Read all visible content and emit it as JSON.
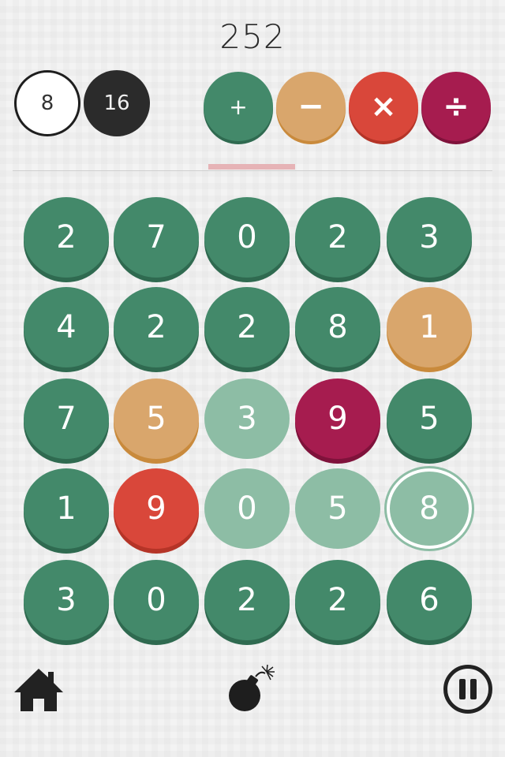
{
  "score": "252",
  "target": "8",
  "current": "16",
  "operators": [
    {
      "symbol": "+",
      "name": "add"
    },
    {
      "symbol": "−",
      "name": "subtract"
    },
    {
      "symbol": "×",
      "name": "multiply"
    },
    {
      "symbol": "÷",
      "name": "divide"
    }
  ],
  "colors": {
    "green": "#43896a",
    "orange": "#d9a66c",
    "red": "#d9473a",
    "crimson": "#a61c4f",
    "faded": "#8dbda5",
    "progress": "#e6b3b6"
  },
  "board": [
    [
      {
        "v": "2",
        "c": "green"
      },
      {
        "v": "7",
        "c": "green"
      },
      {
        "v": "0",
        "c": "green"
      },
      {
        "v": "2",
        "c": "green"
      },
      {
        "v": "3",
        "c": "green"
      }
    ],
    [
      {
        "v": "4",
        "c": "green"
      },
      {
        "v": "2",
        "c": "green"
      },
      {
        "v": "2",
        "c": "green"
      },
      {
        "v": "8",
        "c": "green"
      },
      {
        "v": "1",
        "c": "orange"
      }
    ],
    [
      {
        "v": "7",
        "c": "green"
      },
      {
        "v": "5",
        "c": "orange"
      },
      {
        "v": "3",
        "c": "faded"
      },
      {
        "v": "9",
        "c": "crimson"
      },
      {
        "v": "5",
        "c": "green"
      }
    ],
    [
      {
        "v": "1",
        "c": "green"
      },
      {
        "v": "9",
        "c": "red"
      },
      {
        "v": "0",
        "c": "faded"
      },
      {
        "v": "5",
        "c": "faded"
      },
      {
        "v": "8",
        "c": "selected"
      }
    ],
    [
      {
        "v": "3",
        "c": "green"
      },
      {
        "v": "0",
        "c": "green"
      },
      {
        "v": "2",
        "c": "green"
      },
      {
        "v": "2",
        "c": "green"
      },
      {
        "v": "6",
        "c": "green"
      }
    ]
  ],
  "icons": {
    "home": "home-icon",
    "bomb": "bomb-icon",
    "pause": "pause-icon"
  }
}
